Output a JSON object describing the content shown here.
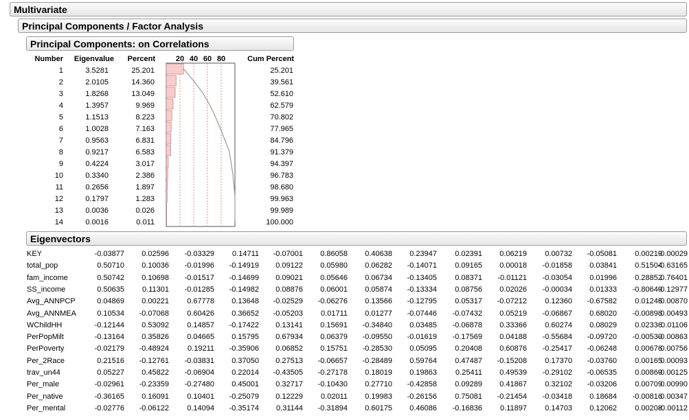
{
  "titles": {
    "multivariate": "Multivariate",
    "pcfa": "Principal Components / Factor Analysis",
    "pc_corr": "Principal Components: on Correlations",
    "eigenvectors": "Eigenvectors"
  },
  "table_headers": {
    "number": "Number",
    "eigenvalue": "Eigenvalue",
    "percent": "Percent",
    "cum_percent": "Cum Percent",
    "axis_ticks": [
      "20",
      "40",
      "60",
      "80"
    ]
  },
  "eigen_rows": [
    {
      "number": "1",
      "eigenvalue": "3.5281",
      "percent": "25.201",
      "cum": "25.201"
    },
    {
      "number": "2",
      "eigenvalue": "2.0105",
      "percent": "14.360",
      "cum": "39.561"
    },
    {
      "number": "3",
      "eigenvalue": "1.8268",
      "percent": "13.049",
      "cum": "52.610"
    },
    {
      "number": "4",
      "eigenvalue": "1.3957",
      "percent": "9.969",
      "cum": "62.579"
    },
    {
      "number": "5",
      "eigenvalue": "1.1513",
      "percent": "8.223",
      "cum": "70.802"
    },
    {
      "number": "6",
      "eigenvalue": "1.0028",
      "percent": "7.163",
      "cum": "77.965"
    },
    {
      "number": "7",
      "eigenvalue": "0.9563",
      "percent": "6.831",
      "cum": "84.796"
    },
    {
      "number": "8",
      "eigenvalue": "0.9217",
      "percent": "6.583",
      "cum": "91.379"
    },
    {
      "number": "9",
      "eigenvalue": "0.4224",
      "percent": "3.017",
      "cum": "94.397"
    },
    {
      "number": "10",
      "eigenvalue": "0.3340",
      "percent": "2.386",
      "cum": "96.783"
    },
    {
      "number": "11",
      "eigenvalue": "0.2656",
      "percent": "1.897",
      "cum": "98.680"
    },
    {
      "number": "12",
      "eigenvalue": "0.1797",
      "percent": "1.283",
      "cum": "99.963"
    },
    {
      "number": "13",
      "eigenvalue": "0.0036",
      "percent": "0.026",
      "cum": "99.989"
    },
    {
      "number": "14",
      "eigenvalue": "0.0016",
      "percent": "0.011",
      "cum": "100.000"
    }
  ],
  "chart_data": {
    "type": "bar",
    "orientation": "horizontal",
    "categories": [
      "1",
      "2",
      "3",
      "4",
      "5",
      "6",
      "7",
      "8",
      "9",
      "10",
      "11",
      "12",
      "13",
      "14"
    ],
    "values": [
      25.201,
      14.36,
      13.049,
      9.969,
      8.223,
      7.163,
      6.831,
      6.583,
      3.017,
      2.386,
      1.897,
      1.283,
      0.026,
      0.011
    ],
    "cumulative": [
      25.201,
      39.561,
      52.61,
      62.579,
      70.802,
      77.965,
      84.796,
      91.379,
      94.397,
      96.783,
      98.68,
      99.963,
      99.989,
      100.0
    ],
    "xlim": [
      0,
      100
    ],
    "xticks": [
      20,
      40,
      60,
      80
    ],
    "grid": true,
    "bar_color": "#f9cccc",
    "bar_edge": "#b07070",
    "line_color": "#999999",
    "grid_color": "#dd8888"
  },
  "eigenvectors": [
    {
      "name": "KEY",
      "values": [
        "-0.03877",
        "0.02596",
        "-0.03329",
        "0.14711",
        "-0.07001",
        "0.86058",
        "0.40638",
        "0.23947",
        "0.02391",
        "0.06219",
        "0.00732",
        "-0.05081",
        "0.00219",
        "-0.00029"
      ]
    },
    {
      "name": "total_pop",
      "values": [
        "0.50710",
        "0.10036",
        "-0.01996",
        "-0.14919",
        "0.09122",
        "0.05980",
        "0.06282",
        "-0.14071",
        "0.09165",
        "0.00018",
        "-0.01858",
        "0.03841",
        "0.51504",
        "-0.63165"
      ]
    },
    {
      "name": "fam_income",
      "values": [
        "0.50742",
        "0.10698",
        "-0.01517",
        "-0.14699",
        "0.09021",
        "0.05646",
        "0.06734",
        "-0.13405",
        "0.08371",
        "-0.01121",
        "-0.03054",
        "0.01996",
        "0.28852",
        "0.76401"
      ]
    },
    {
      "name": "SS_income",
      "values": [
        "0.50635",
        "0.11301",
        "-0.01285",
        "-0.14982",
        "0.08876",
        "0.06001",
        "0.05874",
        "-0.13334",
        "0.08756",
        "0.02026",
        "-0.00034",
        "0.01333",
        "-0.80649",
        "-0.12977"
      ]
    },
    {
      "name": "Avg_ANNPCP",
      "values": [
        "0.04869",
        "0.00221",
        "0.67778",
        "0.13648",
        "-0.02529",
        "-0.06276",
        "0.13566",
        "-0.12795",
        "0.05317",
        "-0.07212",
        "0.12360",
        "-0.67582",
        "0.01245",
        "-0.00870"
      ]
    },
    {
      "name": "Avg_ANNMEA",
      "values": [
        "0.10534",
        "-0.07068",
        "0.60426",
        "0.36652",
        "-0.05203",
        "0.01711",
        "0.01277",
        "-0.07446",
        "-0.07432",
        "0.05219",
        "-0.06867",
        "0.68020",
        "-0.00898",
        "0.00493"
      ]
    },
    {
      "name": "WChildHH",
      "values": [
        "-0.12144",
        "0.53092",
        "0.14857",
        "-0.17422",
        "0.13141",
        "0.15691",
        "-0.34840",
        "0.03485",
        "-0.06878",
        "0.33366",
        "0.60274",
        "0.08029",
        "0.02336",
        "0.01106"
      ]
    },
    {
      "name": "PerPopMilt",
      "values": [
        "-0.13164",
        "0.35826",
        "0.04665",
        "0.15795",
        "0.67934",
        "0.06379",
        "-0.09550",
        "-0.01619",
        "-0.17569",
        "0.04188",
        "-0.55684",
        "-0.09720",
        "-0.00530",
        "-0.00863"
      ]
    },
    {
      "name": "PerPoverty",
      "values": [
        "-0.02179",
        "-0.48924",
        "0.19211",
        "-0.35906",
        "0.06852",
        "0.15751",
        "-0.28530",
        "0.05095",
        "0.20408",
        "0.60876",
        "-0.25417",
        "-0.06248",
        "0.00676",
        "0.00756"
      ]
    },
    {
      "name": "Per_2Race",
      "values": [
        "0.21516",
        "-0.12761",
        "-0.03831",
        "0.37050",
        "0.27513",
        "-0.06657",
        "-0.28489",
        "0.59764",
        "0.47487",
        "-0.15208",
        "0.17370",
        "-0.03760",
        "0.00165",
        "0.00093"
      ]
    },
    {
      "name": "trav_un44",
      "values": [
        "0.05227",
        "0.45822",
        "-0.06904",
        "0.22014",
        "-0.43505",
        "-0.27178",
        "0.18019",
        "0.19863",
        "0.25411",
        "0.49539",
        "-0.29102",
        "-0.06535",
        "0.00869",
        "-0.00125"
      ]
    },
    {
      "name": "Per_male",
      "values": [
        "-0.02961",
        "-0.23359",
        "-0.27480",
        "0.45001",
        "0.32717",
        "-0.10430",
        "0.27710",
        "-0.42858",
        "0.09289",
        "0.41867",
        "0.32102",
        "-0.03206",
        "0.00709",
        "0.00990"
      ]
    },
    {
      "name": "Per_native",
      "values": [
        "-0.36165",
        "0.16091",
        "0.10401",
        "-0.25079",
        "0.12229",
        "0.02011",
        "0.19983",
        "-0.26156",
        "0.75081",
        "-0.21454",
        "-0.03418",
        "0.18684",
        "-0.00816",
        "0.00347"
      ]
    },
    {
      "name": "Per_mental",
      "values": [
        "-0.02776",
        "-0.06122",
        "0.14094",
        "-0.35174",
        "0.31144",
        "-0.31894",
        "0.60175",
        "0.46086",
        "-0.16836",
        "0.11897",
        "0.14703",
        "0.12062",
        "0.00208",
        "-0.00112"
      ]
    }
  ]
}
